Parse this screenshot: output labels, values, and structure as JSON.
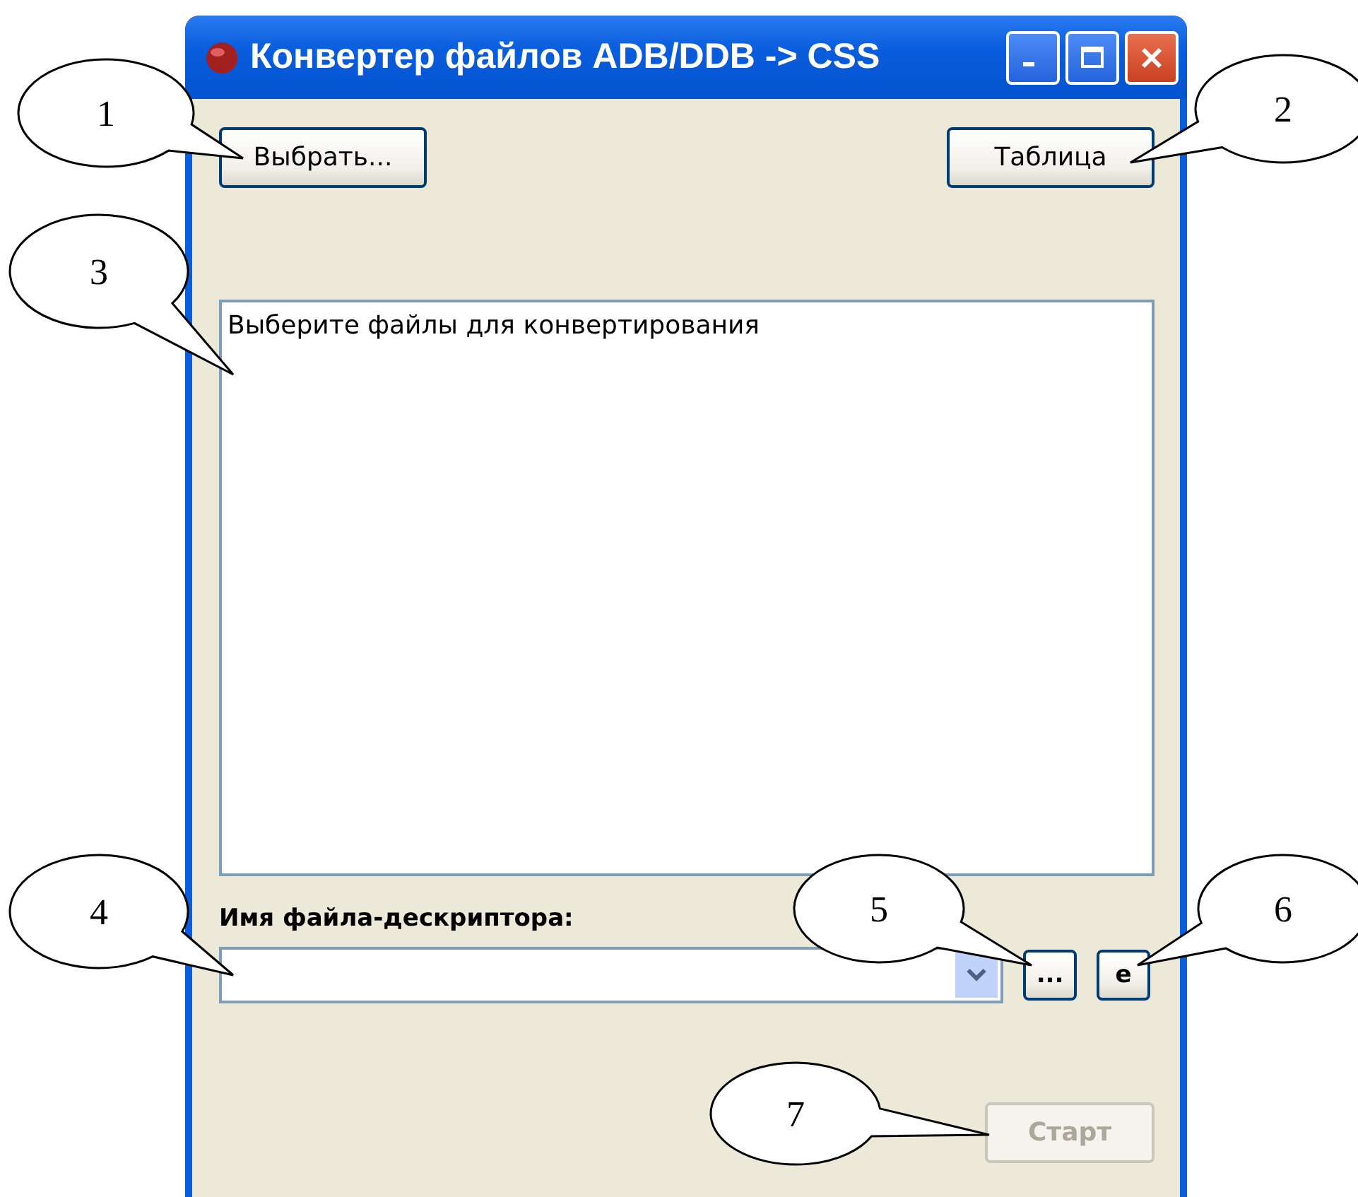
{
  "window": {
    "title": "Конвертер файлов ADB/DDB -> CSS"
  },
  "buttons": {
    "choose": "Выбрать...",
    "table": "Таблица"
  },
  "file_list": {
    "text": "Выберите файлы для конвертирования"
  },
  "descriptor": {
    "label": "Имя файла-дескриптора:",
    "browse": "...",
    "edit": "e"
  },
  "start": {
    "label": "Старт",
    "disabled": true
  },
  "callouts": [
    {
      "label": "1"
    },
    {
      "label": "2"
    },
    {
      "label": "3"
    },
    {
      "label": "4"
    },
    {
      "label": "5"
    },
    {
      "label": "6"
    },
    {
      "label": "7"
    }
  ]
}
